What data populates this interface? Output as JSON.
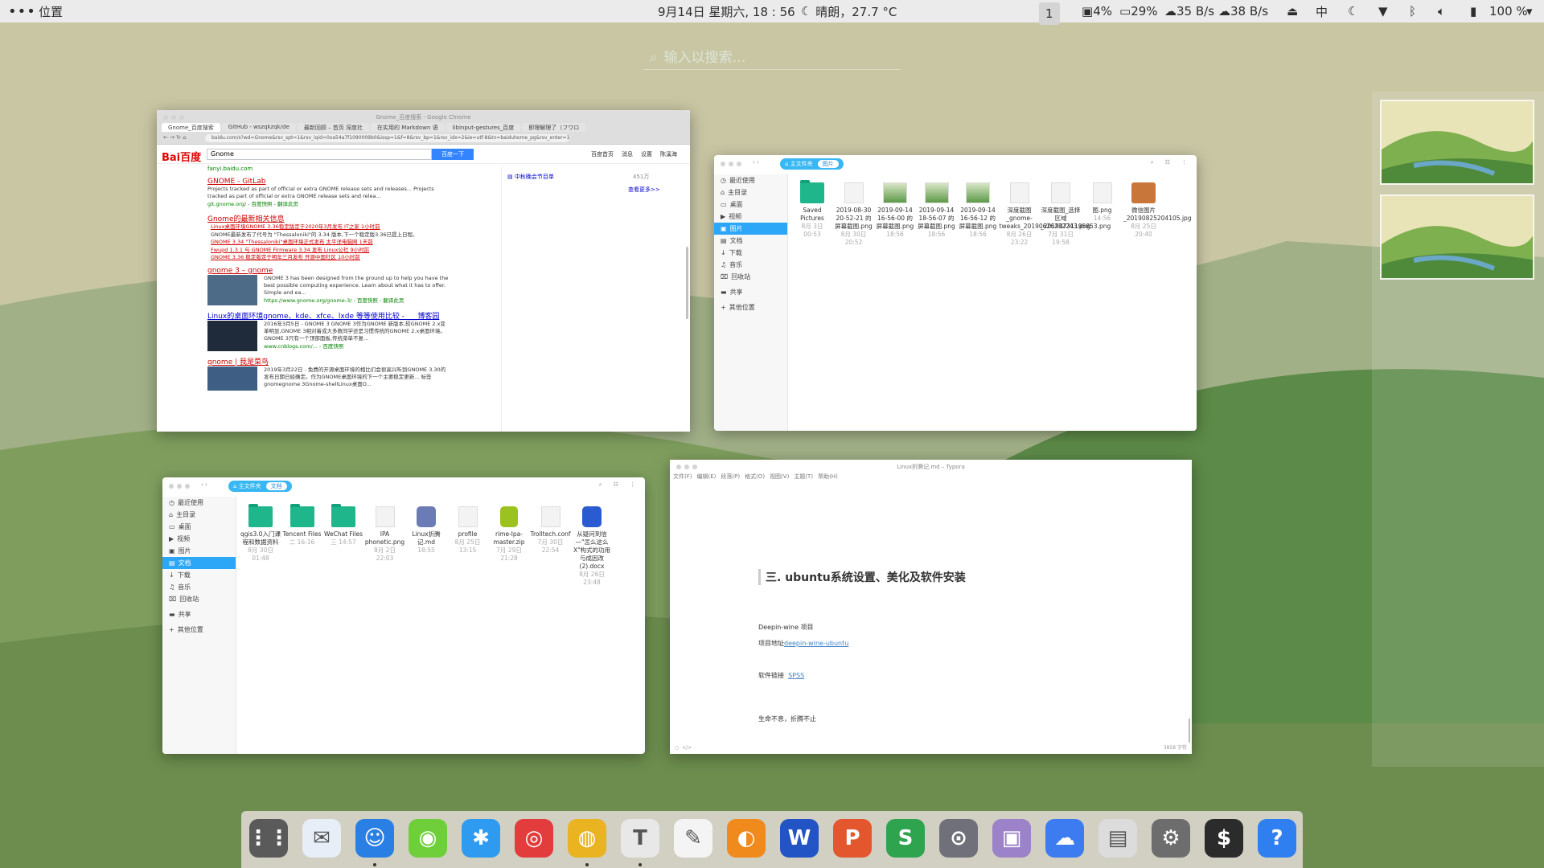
{
  "topbar": {
    "menu_icon": "dots-menu-icon",
    "location": "位置",
    "datetime": "9月14日 星期六, 18 : 56",
    "weather": "晴朗，27.7 °C",
    "workspace": "1",
    "disk": "4%",
    "mem": "29%",
    "net_up": "35 B/s",
    "net_down": "38 B/s",
    "input_method": "中",
    "battery": "100 %"
  },
  "search": {
    "placeholder": "输入以搜索…"
  },
  "chrome": {
    "title": "Gnome_百度搜索 - Google Chrome",
    "tabs": [
      "Gnome_百度搜索",
      "GitHub - wszqkzqk/de",
      "最新回顾 – 首页 深度社",
      "在实用的 Markdown 语",
      "libinput-gestures_百度",
      "即理解理了（フワロ"
    ],
    "url": "baidu.com/s?wd=Gnome&rsv_spt=1&rsv_iqid=0xa54a7f1090009b0&issp=1&f=8&rsv_bp=1&rsv_idx=2&ie=utf-8&tn=baiduhome_pg&rsv_enter=1&rsv",
    "logo": "Bai百度",
    "query": "Gnome",
    "search_btn": "百度一下",
    "top_links": [
      "百度首页",
      "消息",
      "设置",
      "陈溪海"
    ],
    "sidebar_link": "中秋晚会节目单",
    "sidebar_count": "451万",
    "more": "查看更多>>",
    "header_url": "fanyi.baidu.com",
    "results": [
      {
        "title": "GNOME - GitLab",
        "desc": "Projects tracked as part of official or extra GNOME release sets and releases... Projects tracked as part of official or extra GNOME release sets and relea...",
        "site": "git.gnome.org/ - 百度快照 - 翻译此页"
      },
      {
        "title": "Gnome的最新相关信息",
        "news": [
          "Linux桌面环境GNOME 3.36稳定版定于2020年3月发布  IT之家  1小时前",
          "GNOME最新发布了代号为 \"Thessaloniki\"的 3.34 版本,下一个稳定版3.36已提上日程。",
          "GNOME 3.34 \"Thessaloniki\"桌面环境正式发布  太平洋电脑网  1天前",
          "Fwupd 1.3.1 与 GNOME Firmware 3.34 发布  Linux公社  9小时前",
          "GNOME 3.36 稳定版定于明年三月发布  开源中国社区  10小时前"
        ]
      },
      {
        "title": "gnome 3 – gnome",
        "desc": "GNOME 3 has been designed from the ground up to help you have the best possible computing experience. Learn about what it has to offer. Simple and ea...",
        "site": "https://www.gnome.org/gnome-3/ - 百度快照 - 翻译此页"
      },
      {
        "title": "Linux的桌面环境gnome、kde、xfce、lxde 等等使用比较 - ___博客园",
        "desc": "2016年3月5日 - GNOME 3 GNOME 3作为GNOME 新版本,较GNOME 2.x变革明显,GNOME 3相对着或大多数同学还是习惯传统的GNOME 2.x桌面环境。GNOME 3只有一个顶部面板,传统菜单不复...",
        "site": "www.cnblogs.com/... - 百度快照"
      },
      {
        "title": "gnome | 我是菜鸟",
        "desc": "2019年3月22日 - 免费的开源桌面环境的相比们会很高兴听到GNOME 3.30的发布日期已经确定。作为GNOME桌面环境的下一个主要稳定更新... 标签 gnomegnome 3Gnome-shellLinux桌面O..."
      }
    ]
  },
  "fm_pictures": {
    "crumb_home": "主文件夹",
    "crumb_current": "图片",
    "sidebar": [
      "最近使用",
      "主目录",
      "桌面",
      "视频",
      "图片",
      "文档",
      "下载",
      "音乐",
      "回收站",
      "共享",
      "其他位置"
    ],
    "selected": "图片",
    "items": [
      {
        "name": "Saved Pictures",
        "date": "8月 3日 00:53",
        "type": "folder"
      },
      {
        "name": "2019-08-30 20-52-21 的屏幕截图.png",
        "date": "8月 30日 20:52",
        "type": "doc"
      },
      {
        "name": "2019-09-14 16-56-00 的屏幕截图.png",
        "date": "18:56",
        "type": "thumb"
      },
      {
        "name": "2019-09-14 18-56-07 的屏幕截图.png",
        "date": "18:56",
        "type": "thumb"
      },
      {
        "name": "2019-09-14 16-56-12 的屏幕截图.png",
        "date": "18:56",
        "type": "thumb"
      },
      {
        "name": "深度截图_gnome-tweaks_20190626232243.png",
        "date": "8月 26日 23:22",
        "type": "doc"
      },
      {
        "name": "深度截图_选择区域_20190731195853.png",
        "date": "7月 31日 19:58",
        "type": "doc"
      },
      {
        "name": "图.png",
        "date": "14:56",
        "type": "doc"
      },
      {
        "name": "微信图片_20190825204105.jpg",
        "date": "8月 25日 20:40",
        "type": "face"
      }
    ]
  },
  "fm_documents": {
    "crumb_home": "主文件夹",
    "crumb_current": "文档",
    "sidebar": [
      "最近使用",
      "主目录",
      "桌面",
      "视频",
      "图片",
      "文档",
      "下载",
      "音乐",
      "回收站",
      "共享",
      "其他位置"
    ],
    "selected": "文档",
    "items": [
      {
        "name": "qgis3.0入门课程和数据资料",
        "date": "8月 30日 01:48",
        "type": "folder"
      },
      {
        "name": "Tencent Files",
        "date": "二 16:16",
        "type": "folder"
      },
      {
        "name": "WeChat Files",
        "date": "三 14:57",
        "type": "folder"
      },
      {
        "name": "IPA phonetic.png",
        "date": "8月 2日 22:03",
        "type": "doc"
      },
      {
        "name": "Linux折腾记.md",
        "date": "18:55",
        "type": "md"
      },
      {
        "name": "profile",
        "date": "8月 25日 13:15",
        "type": "doc"
      },
      {
        "name": "rime-lpa-master.zip",
        "date": "7月 29日 21:28",
        "type": "zip"
      },
      {
        "name": "Trolltech.conf",
        "date": "7月 30日 22:54",
        "type": "doc"
      },
      {
        "name": "从疑问到信—\"怎么这么X\"构式的功用与成因改 (2).docx",
        "date": "8月 26日 23:48",
        "type": "word"
      }
    ]
  },
  "typora": {
    "title": "Linux折腾记.md – Typora",
    "menu": [
      "文件(F)",
      "编辑(E)",
      "段落(P)",
      "格式(O)",
      "视图(V)",
      "主题(T)",
      "帮助(H)"
    ],
    "heading": "三. ubuntu系统设置、美化及软件安装",
    "p1": "Deepin-wine 项目",
    "p2_label": "项目地址",
    "p2_link": "deepin-wine-ubuntu",
    "p3_label": "软件链接",
    "p3_link": "SPSS",
    "p4": "生命不息，折腾不止",
    "status_left": "</>",
    "word_count": "3858 字符"
  },
  "dock": {
    "apps": [
      {
        "name": "app-grid",
        "glyph": "⋮⋮",
        "color": "#5a5a5a"
      },
      {
        "name": "mail",
        "glyph": "✉",
        "color": "#e7eef7"
      },
      {
        "name": "finder",
        "glyph": "☺",
        "color": "#2a7fe4"
      },
      {
        "name": "wechat",
        "glyph": "◉",
        "color": "#6fcf3a"
      },
      {
        "name": "tim",
        "glyph": "✱",
        "color": "#2e9bf0"
      },
      {
        "name": "netease-music",
        "glyph": "◎",
        "color": "#e23c3c"
      },
      {
        "name": "chrome",
        "glyph": "◍",
        "color": "#e9b321"
      },
      {
        "name": "typora",
        "glyph": "T",
        "color": "#e8e8e8"
      },
      {
        "name": "text-editor",
        "glyph": "✎",
        "color": "#f4f4f4"
      },
      {
        "name": "vlc",
        "glyph": "◐",
        "color": "#f08a1c"
      },
      {
        "name": "wps-writer",
        "glyph": "W",
        "color": "#2254c5"
      },
      {
        "name": "wps-presentation",
        "glyph": "P",
        "color": "#e4572e"
      },
      {
        "name": "wps-spreadsheets",
        "glyph": "S",
        "color": "#2ea44f"
      },
      {
        "name": "screenshot",
        "glyph": "⊙",
        "color": "#70707a"
      },
      {
        "name": "screen-recorder",
        "glyph": "▣",
        "color": "#9b82c9"
      },
      {
        "name": "baidu-netdisk",
        "glyph": "☁",
        "color": "#3c7cf0"
      },
      {
        "name": "clipboard",
        "glyph": "▤",
        "color": "#dcdcdc"
      },
      {
        "name": "settings",
        "glyph": "⚙",
        "color": "#6d6d6d"
      },
      {
        "name": "terminal",
        "glyph": "$",
        "color": "#2b2b2b"
      },
      {
        "name": "help",
        "glyph": "?",
        "color": "#2f7ff0"
      }
    ]
  }
}
